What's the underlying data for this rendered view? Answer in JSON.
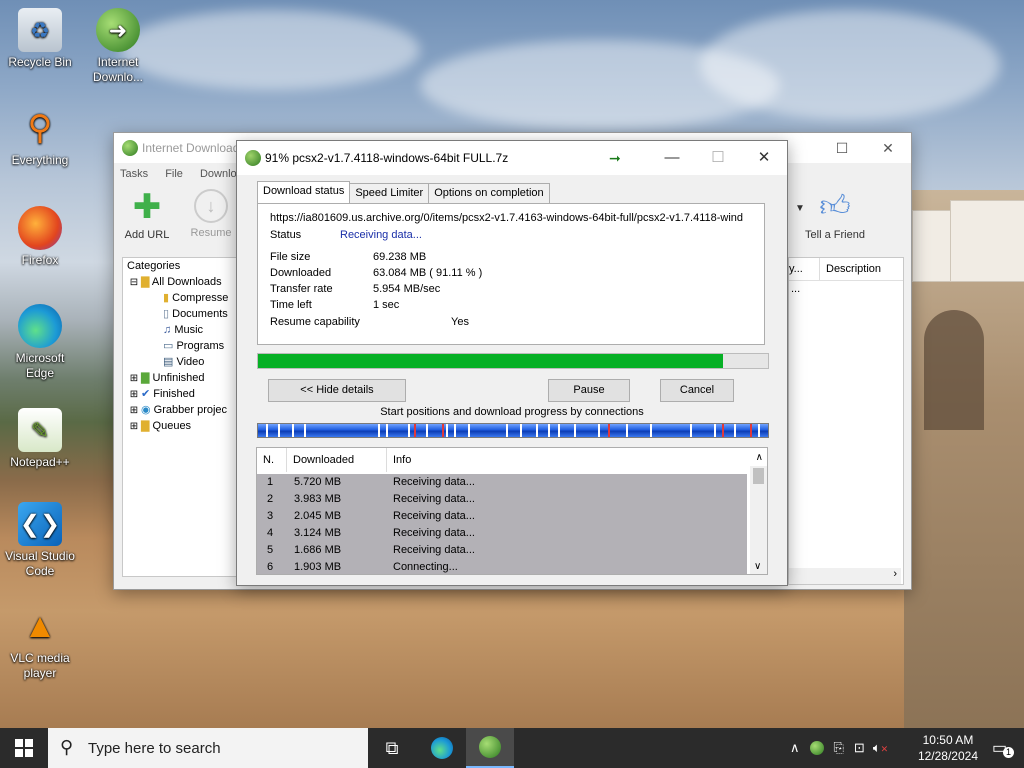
{
  "desktop": {
    "icons": [
      {
        "label": "Recycle Bin"
      },
      {
        "label": "Internet Downlo..."
      },
      {
        "label": "Everything"
      },
      {
        "label": "Firefox"
      },
      {
        "label": "Microsoft Edge"
      },
      {
        "label": "Notepad++"
      },
      {
        "label": "Visual Studio Code"
      },
      {
        "label": "VLC media player"
      }
    ]
  },
  "idm_main": {
    "title": "Internet Download",
    "menu": [
      "Tasks",
      "File",
      "Downlo"
    ],
    "toolbar": {
      "add_url": "Add URL",
      "resume": "Resume",
      "tell_friend": "Tell a Friend"
    },
    "categories_header": "Categories",
    "tree": [
      "All Downloads",
      "Compresse",
      "Documents",
      "Music",
      "Programs",
      "Video",
      "Unfinished",
      "Finished",
      "Grabber projec",
      "Queues"
    ],
    "list_headers": {
      "col1": "y...",
      "description": "Description"
    },
    "list_row_fragment": "..."
  },
  "dialog": {
    "title": "91% pcsx2-v1.7.4118-windows-64bit FULL.7z",
    "tabs": [
      "Download status",
      "Speed Limiter",
      "Options on completion"
    ],
    "url": "https://ia801609.us.archive.org/0/items/pcsx2-v1.7.4163-windows-64bit-full/pcsx2-v1.7.4118-wind",
    "status_label": "Status",
    "status_value": "Receiving data...",
    "file_size_label": "File size",
    "file_size_value": "69.238  MB",
    "downloaded_label": "Downloaded",
    "downloaded_value": "63.084  MB  ( 91.11 % )",
    "transfer_rate_label": "Transfer rate",
    "transfer_rate_value": "5.954  MB/sec",
    "time_left_label": "Time left",
    "time_left_value": "1 sec",
    "resume_label": "Resume capability",
    "resume_value": "Yes",
    "progress": 0.9111,
    "buttons": {
      "hide_details": "<< Hide details",
      "pause": "Pause",
      "cancel": "Cancel"
    },
    "connections_caption": "Start positions and download progress by connections",
    "table_headers": {
      "n": "N.",
      "downloaded": "Downloaded",
      "info": "Info"
    },
    "connections": [
      {
        "n": "1",
        "downloaded": "5.720  MB",
        "info": "Receiving data..."
      },
      {
        "n": "2",
        "downloaded": "3.983  MB",
        "info": "Receiving data..."
      },
      {
        "n": "3",
        "downloaded": "2.045  MB",
        "info": "Receiving data..."
      },
      {
        "n": "4",
        "downloaded": "3.124  MB",
        "info": "Receiving data..."
      },
      {
        "n": "5",
        "downloaded": "1.686  MB",
        "info": "Receiving data..."
      },
      {
        "n": "6",
        "downloaded": "1.903  MB",
        "info": "Connecting..."
      }
    ]
  },
  "taskbar": {
    "search_placeholder": "Type here to search",
    "time": "10:50 AM",
    "date": "12/28/2024",
    "notification_count": "1"
  },
  "colors": {
    "progress": "#06b025",
    "taskbar": "#2b2b2b",
    "conn_bar": "#1e5de0"
  }
}
